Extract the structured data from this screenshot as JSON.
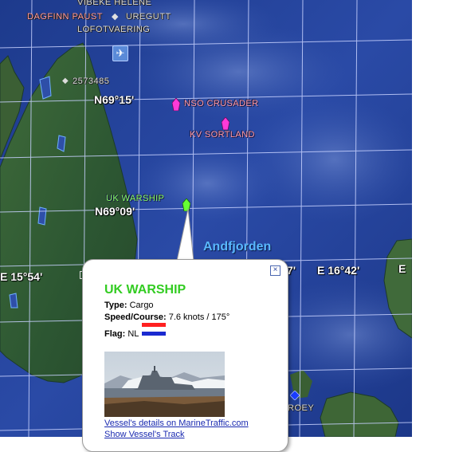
{
  "map": {
    "place_labels": [
      "VIBEKE HELENE",
      "DAGFINN PAUST",
      "UREGUTT",
      "LOFOTVAERING",
      "2573485",
      "ROEY"
    ],
    "coordinate_labels": [
      "N69°15'",
      "N69°09'",
      "E 15°54'",
      "E 16°42'",
      "7'",
      "E"
    ],
    "water_label": "Andfjorden",
    "vessels": [
      {
        "name": "NSO CRUSADER",
        "color": "#ff3ad8"
      },
      {
        "name": "KV SORTLAND",
        "color": "#ff3ad8"
      },
      {
        "name": "UK WARSHIP",
        "color": "#66ff33"
      }
    ],
    "other_marker_color": "#1a3cff",
    "airport_icon": "airport-icon"
  },
  "popup": {
    "title": "UK WARSHIP",
    "title_color": "#33cc22",
    "type_label": "Type:",
    "type_value": "Cargo",
    "speed_label": "Speed/Course:",
    "speed_value": "7.6 knots / 175°",
    "flag_label": "Flag:",
    "flag_value": "NL",
    "flag_colors": [
      "#ff2020",
      "#ffffff",
      "#1a2ad0"
    ],
    "close_icon": "close-icon",
    "photo_icon": "vessel-photo",
    "link_details": "Vessel's details on MarineTraffic.com",
    "link_track": "Show Vessel's Track"
  }
}
